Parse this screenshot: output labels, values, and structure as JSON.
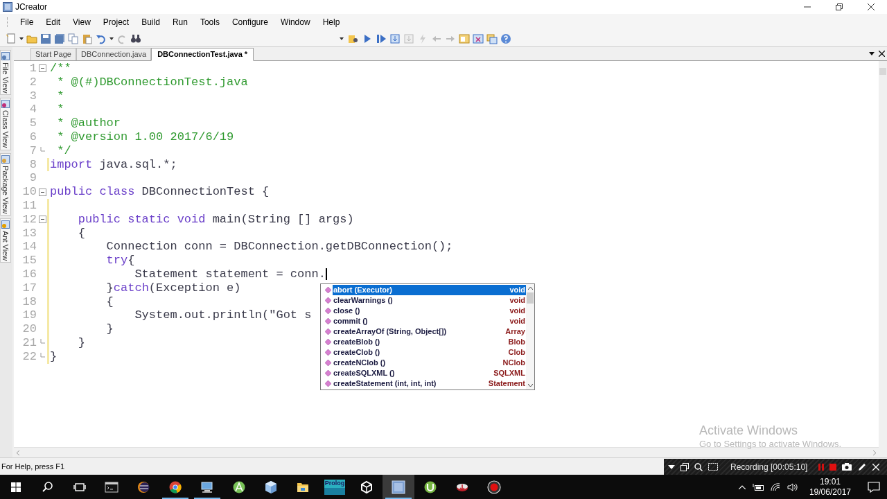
{
  "window": {
    "title": "JCreator"
  },
  "menu": [
    "File",
    "Edit",
    "View",
    "Project",
    "Build",
    "Run",
    "Tools",
    "Configure",
    "Window",
    "Help"
  ],
  "side_tabs": [
    {
      "label": "File View"
    },
    {
      "label": "Class View"
    },
    {
      "label": "Package View"
    },
    {
      "label": "Ant View"
    }
  ],
  "editor_tabs": [
    {
      "label": "Start Page",
      "selected": false
    },
    {
      "label": "DBConnection.java",
      "selected": false
    },
    {
      "label": "DBConnectionTest.java *",
      "selected": true
    }
  ],
  "code_lines": [
    {
      "number": "1",
      "fold_start": true,
      "fold_end": false,
      "modified": false,
      "tokens": [
        {
          "kind": "comment",
          "text": "/**"
        }
      ]
    },
    {
      "number": "2",
      "fold_start": false,
      "fold_end": false,
      "modified": false,
      "tokens": [
        {
          "kind": "comment",
          "text": " * @(#)DBConnectionTest.java"
        }
      ]
    },
    {
      "number": "3",
      "fold_start": false,
      "fold_end": false,
      "modified": false,
      "tokens": [
        {
          "kind": "comment",
          "text": " *"
        }
      ]
    },
    {
      "number": "4",
      "fold_start": false,
      "fold_end": false,
      "modified": false,
      "tokens": [
        {
          "kind": "comment",
          "text": " *"
        }
      ]
    },
    {
      "number": "5",
      "fold_start": false,
      "fold_end": false,
      "modified": false,
      "tokens": [
        {
          "kind": "comment",
          "text": " * @author"
        }
      ]
    },
    {
      "number": "6",
      "fold_start": false,
      "fold_end": false,
      "modified": false,
      "tokens": [
        {
          "kind": "comment",
          "text": " * @version 1.00 2017/6/19"
        }
      ]
    },
    {
      "number": "7",
      "fold_start": false,
      "fold_end": true,
      "modified": false,
      "tokens": [
        {
          "kind": "comment",
          "text": " */"
        }
      ]
    },
    {
      "number": "8",
      "fold_start": false,
      "fold_end": false,
      "modified": true,
      "tokens": [
        {
          "kind": "keyword",
          "text": "import"
        },
        {
          "kind": "plain",
          "text": " java.sql.*;"
        }
      ]
    },
    {
      "number": "9",
      "fold_start": false,
      "fold_end": false,
      "modified": false
    },
    {
      "number": "10",
      "fold_start": true,
      "fold_end": false,
      "modified": false,
      "tokens": [
        {
          "kind": "keyword",
          "text": "public class"
        },
        {
          "kind": "plain",
          "text": " DBConnectionTest {"
        }
      ]
    },
    {
      "number": "11",
      "fold_start": false,
      "fold_end": false,
      "modified": true
    },
    {
      "number": "12",
      "fold_start": true,
      "fold_end": false,
      "modified": true,
      "tokens": [
        {
          "kind": "keyword",
          "text": "    public static void"
        },
        {
          "kind": "plain",
          "text": " main(String [] args)"
        }
      ]
    },
    {
      "number": "13",
      "fold_start": false,
      "fold_end": false,
      "modified": true,
      "tokens": [
        {
          "kind": "plain",
          "text": "    {"
        }
      ]
    },
    {
      "number": "14",
      "fold_start": false,
      "fold_end": false,
      "modified": true,
      "tokens": [
        {
          "kind": "plain",
          "text": "        Connection conn = DBConnection.getDBConnection();"
        }
      ]
    },
    {
      "number": "15",
      "fold_start": false,
      "fold_end": false,
      "modified": true,
      "tokens": [
        {
          "kind": "keyword",
          "text": "        try"
        },
        {
          "kind": "plain",
          "text": "{"
        }
      ]
    },
    {
      "number": "16",
      "fold_start": false,
      "fold_end": false,
      "modified": true,
      "caret": true,
      "tokens": [
        {
          "kind": "plain",
          "text": "            Statement statement = conn."
        }
      ]
    },
    {
      "number": "17",
      "fold_start": false,
      "fold_end": false,
      "modified": true,
      "tokens": [
        {
          "kind": "plain",
          "text": "        }"
        },
        {
          "kind": "keyword",
          "text": "catch"
        },
        {
          "kind": "plain",
          "text": "(Exception e)"
        }
      ]
    },
    {
      "number": "18",
      "fold_start": false,
      "fold_end": false,
      "modified": true,
      "tokens": [
        {
          "kind": "plain",
          "text": "        {"
        }
      ]
    },
    {
      "number": "19",
      "fold_start": false,
      "fold_end": false,
      "modified": true,
      "tokens": [
        {
          "kind": "plain",
          "text": "            System.out.println(\"Got s"
        }
      ]
    },
    {
      "number": "20",
      "fold_start": false,
      "fold_end": false,
      "modified": true,
      "tokens": [
        {
          "kind": "plain",
          "text": "        }"
        }
      ]
    },
    {
      "number": "21",
      "fold_start": false,
      "fold_end": true,
      "modified": true,
      "tokens": [
        {
          "kind": "plain",
          "text": "    }"
        }
      ]
    },
    {
      "number": "22",
      "fold_start": false,
      "fold_end": true,
      "modified": true,
      "tokens": [
        {
          "kind": "plain",
          "text": "}"
        }
      ]
    }
  ],
  "autocomplete": {
    "items": [
      {
        "name": "abort (Executor)",
        "type": "void",
        "selected": true
      },
      {
        "name": "clearWarnings ()",
        "type": "void",
        "selected": false
      },
      {
        "name": "close ()",
        "type": "void",
        "selected": false
      },
      {
        "name": "commit ()",
        "type": "void",
        "selected": false
      },
      {
        "name": "createArrayOf (String, Object[])",
        "type": "Array",
        "selected": false
      },
      {
        "name": "createBlob ()",
        "type": "Blob",
        "selected": false
      },
      {
        "name": "createClob ()",
        "type": "Clob",
        "selected": false
      },
      {
        "name": "createNClob ()",
        "type": "NClob",
        "selected": false
      },
      {
        "name": "createSQLXML ()",
        "type": "SQLXML",
        "selected": false
      },
      {
        "name": "createStatement (int, int, int)",
        "type": "Statement",
        "selected": false
      }
    ]
  },
  "activation_notice": {
    "title": "Activate Windows",
    "subtitle": "Go to Settings to activate Windows."
  },
  "status_bar": {
    "text": "For Help, press F1"
  },
  "recorder_bar": {
    "status": "Recording [00:05:10]"
  },
  "taskbar": {
    "apps": [
      {
        "kind": "start",
        "running": false,
        "active": false
      },
      {
        "kind": "search",
        "running": false,
        "active": false
      },
      {
        "kind": "taskview",
        "running": false,
        "active": false
      },
      {
        "kind": "terminal",
        "running": false,
        "active": false
      },
      {
        "kind": "eclipse",
        "running": false,
        "active": false
      },
      {
        "kind": "chrome",
        "running": true,
        "active": false
      },
      {
        "kind": "computer",
        "running": true,
        "active": false
      },
      {
        "kind": "android",
        "running": false,
        "active": false
      },
      {
        "kind": "cube",
        "running": false,
        "active": false
      },
      {
        "kind": "folder",
        "running": false,
        "active": false
      },
      {
        "kind": "prolog",
        "label": "Prolog",
        "running": false,
        "active": false
      },
      {
        "kind": "unity",
        "running": false,
        "active": false
      },
      {
        "kind": "jcreator",
        "running": true,
        "active": true
      },
      {
        "kind": "torrent",
        "running": false,
        "active": false
      },
      {
        "kind": "download",
        "running": false,
        "active": false
      },
      {
        "kind": "record",
        "running": false,
        "active": false
      }
    ],
    "clock": {
      "time": "19:01",
      "date": "19/06/2017"
    }
  }
}
